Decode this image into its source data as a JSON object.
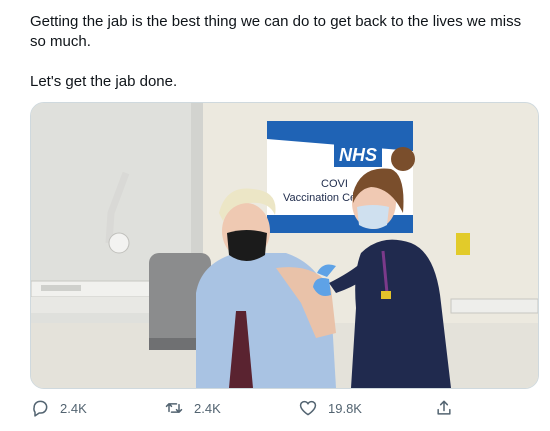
{
  "tweet": {
    "text_line1": "Getting the jab is the best thing we can do to get back to the lives we miss so much.",
    "text_line2": "Let's get the jab done."
  },
  "media": {
    "sign": {
      "logo": "NHS",
      "line1": "COVI",
      "line2": "Vaccination Ce"
    }
  },
  "actions": {
    "reply_count": "2.4K",
    "retweet_count": "2.4K",
    "like_count": "19.8K"
  },
  "icons": {
    "reply": "reply-icon",
    "retweet": "retweet-icon",
    "like": "heart-icon",
    "share": "share-icon"
  },
  "colors": {
    "nhs_blue": "#1f63b5",
    "icon_gray": "#536471"
  }
}
